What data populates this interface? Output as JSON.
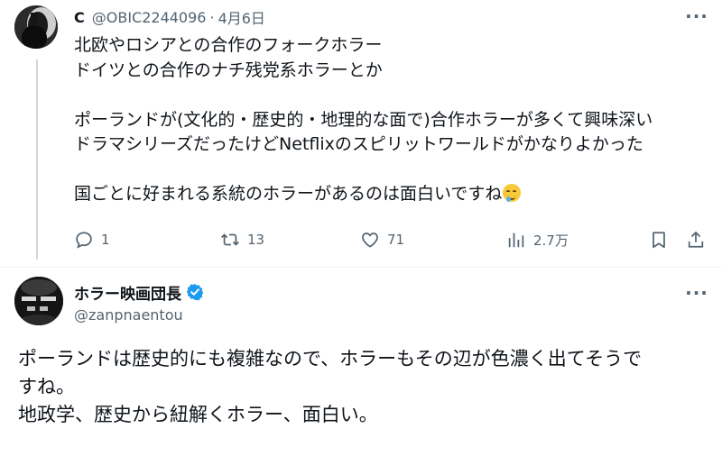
{
  "colors": {
    "text": "#0f1419",
    "muted": "#536471",
    "verified": "#1d9bf0",
    "thread_line": "#cfd9de"
  },
  "post1": {
    "avatar_icon": "silhouette-avatar",
    "display_name": "C",
    "handle": "@OBIC2244096",
    "separator": "·",
    "date": "4月6日",
    "lines": [
      "北欧やロシアとの合作のフォークホラー",
      "ドイツとの合作のナチ残党系ホラーとか",
      "",
      "ポーランドが(文化的・歴史的・地理的な面で)合作ホラーが多くて興味深い",
      "ドラマシリーズだったけどNetflixのスピリットワールドがかなりよかった",
      "",
      "国ごとに好まれる系統のホラーがあるのは面白いですね"
    ],
    "emoji": "drooling-face",
    "actions": {
      "reply_count": "1",
      "repost_count": "13",
      "like_count": "71",
      "views_count": "2.7万"
    }
  },
  "post2": {
    "avatar_icon": "horror-channel-avatar",
    "display_name": "ホラー映画団長",
    "verified_icon": "verified-badge-icon",
    "handle": "@zanpnaentou",
    "lines": [
      "ポーランドは歴史的にも複雑なので、ホラーもその辺が色濃く出てそうで",
      "すね。",
      "地政学、歴史から紐解くホラー、面白い。"
    ]
  }
}
